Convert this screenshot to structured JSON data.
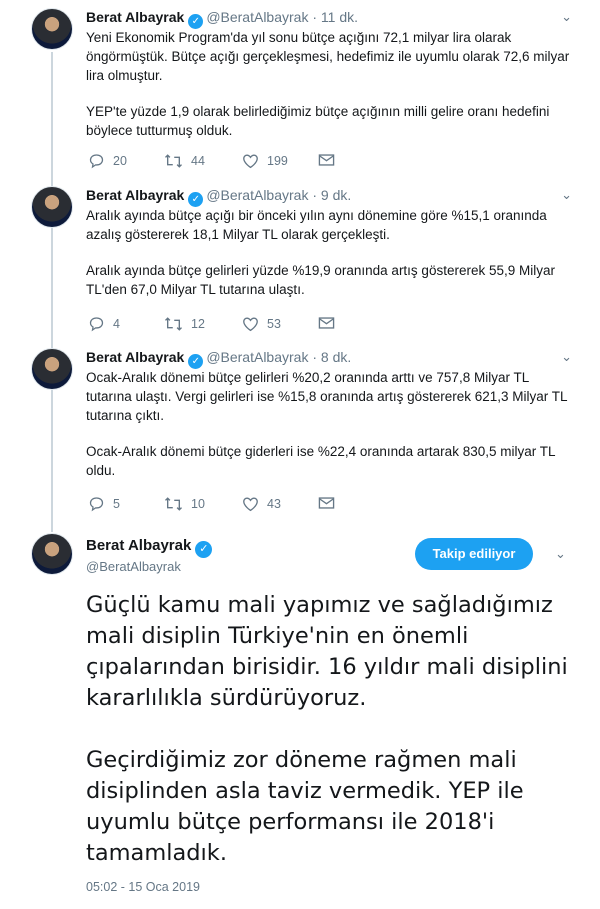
{
  "thread": [
    {
      "name": "Berat Albayrak",
      "handle": "@BeratAlbayrak",
      "time": "· 11 dk.",
      "paragraphs": [
        "Yeni Ekonomik Program'da yıl sonu bütçe açığını 72,1 milyar lira olarak öngörmüştük. Bütçe açığı gerçekleşmesi, hedefimiz ile uyumlu olarak 72,6 milyar lira olmuştur.",
        "YEP'te yüzde 1,9 olarak belirlediğimiz bütçe açığının milli gelire oranı hedefini böylece tutturmuş olduk."
      ],
      "replies": "20",
      "retweets": "44",
      "likes": "199"
    },
    {
      "name": "Berat Albayrak",
      "handle": "@BeratAlbayrak",
      "time": "· 9 dk.",
      "paragraphs": [
        "Aralık ayında bütçe açığı bir önceki yılın aynı dönemine göre %15,1 oranında azalış göstererek 18,1 Milyar TL olarak gerçekleşti.",
        "Aralık ayında bütçe gelirleri yüzde %19,9 oranında artış göstererek 55,9 Milyar TL'den 67,0 Milyar TL tutarına ulaştı."
      ],
      "replies": "4",
      "retweets": "12",
      "likes": "53"
    },
    {
      "name": "Berat Albayrak",
      "handle": "@BeratAlbayrak",
      "time": "· 8 dk.",
      "paragraphs": [
        "Ocak-Aralık dönemi bütçe gelirleri %20,2 oranında arttı ve 757,8 Milyar TL tutarına ulaştı. Vergi gelirleri ise %15,8 oranında artış göstererek 621,3 Milyar TL tutarına çıktı.",
        "Ocak-Aralık dönemi bütçe giderleri ise %22,4 oranında artarak 830,5 milyar TL oldu."
      ],
      "replies": "5",
      "retweets": "10",
      "likes": "43"
    }
  ],
  "main": {
    "name": "Berat Albayrak",
    "handle": "@BeratAlbayrak",
    "follow_label": "Takip ediliyor",
    "paragraphs": [
      "Güçlü kamu mali yapımız ve sağladığımız mali disiplin Türkiye'nin en önemli çıpalarından birisidir. 16 yıldır mali disiplini kararlılıkla sürdürüyoruz.",
      "Geçirdiğimiz zor döneme rağmen mali disiplinden asla taviz vermedik. YEP ile uyumlu bütçe performansı ile 2018'i tamamladık."
    ],
    "timestamp": "05:02 - 15 Oca 2019"
  },
  "colors": {
    "accent": "#1da1f2",
    "text": "#14171a",
    "muted": "#657786",
    "border": "#e6ecf0"
  },
  "icons": [
    "verified-badge-icon",
    "chevron-down-icon",
    "reply-icon",
    "retweet-icon",
    "like-icon",
    "message-icon"
  ]
}
